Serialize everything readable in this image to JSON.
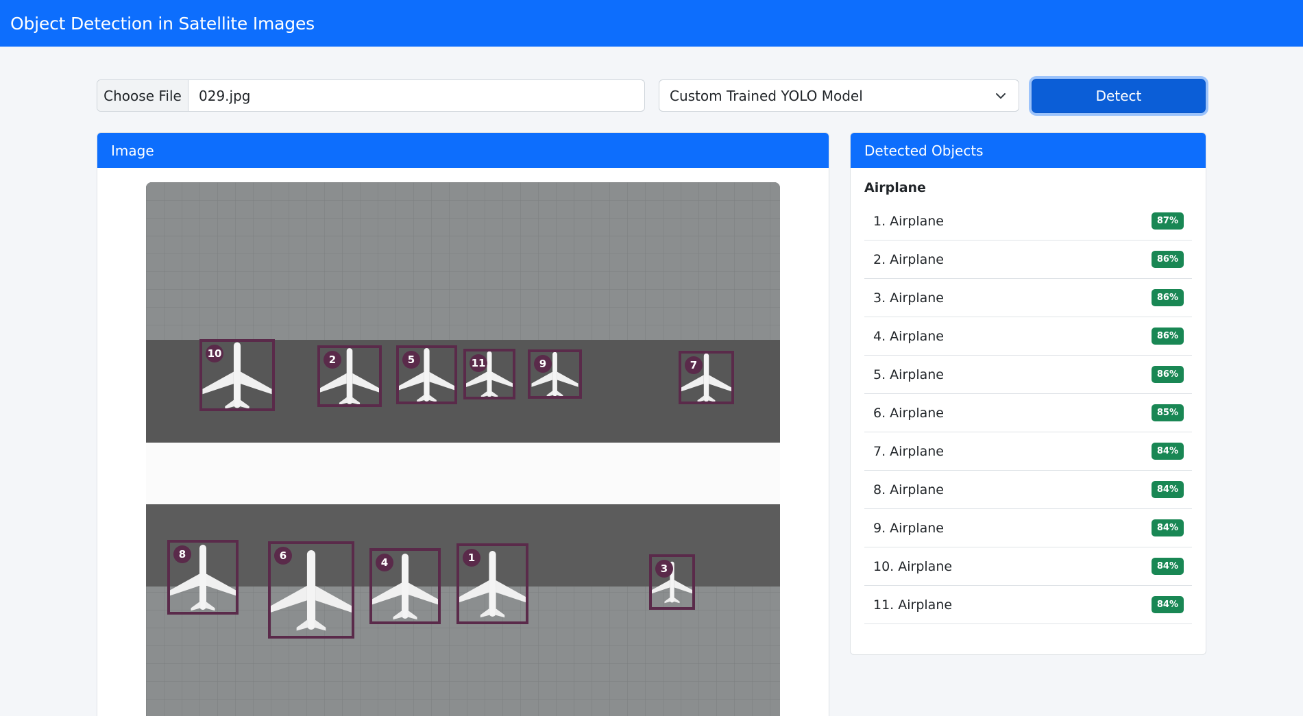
{
  "app": {
    "title": "Object Detection in Satellite Images"
  },
  "controls": {
    "choose_file_label": "Choose File",
    "file_name": "029.jpg",
    "model_selected": "Custom Trained YOLO Model",
    "detect_label": "Detect"
  },
  "image_panel": {
    "title": "Image"
  },
  "detections_panel": {
    "title": "Detected Objects",
    "group_label": "Airplane",
    "items": [
      {
        "label": "1. Airplane",
        "confidence": "87%"
      },
      {
        "label": "2. Airplane",
        "confidence": "86%"
      },
      {
        "label": "3. Airplane",
        "confidence": "86%"
      },
      {
        "label": "4. Airplane",
        "confidence": "86%"
      },
      {
        "label": "5. Airplane",
        "confidence": "86%"
      },
      {
        "label": "6. Airplane",
        "confidence": "85%"
      },
      {
        "label": "7. Airplane",
        "confidence": "84%"
      },
      {
        "label": "8. Airplane",
        "confidence": "84%"
      },
      {
        "label": "9. Airplane",
        "confidence": "84%"
      },
      {
        "label": "10. Airplane",
        "confidence": "84%"
      },
      {
        "label": "11. Airplane",
        "confidence": "84%"
      }
    ]
  },
  "bounding_box_labels": [
    "1",
    "2",
    "3",
    "4",
    "5",
    "6",
    "7",
    "8",
    "9",
    "10",
    "11"
  ],
  "colors": {
    "primary": "#0d6efd",
    "badge": "#198754",
    "box": "#5a2a4a"
  }
}
